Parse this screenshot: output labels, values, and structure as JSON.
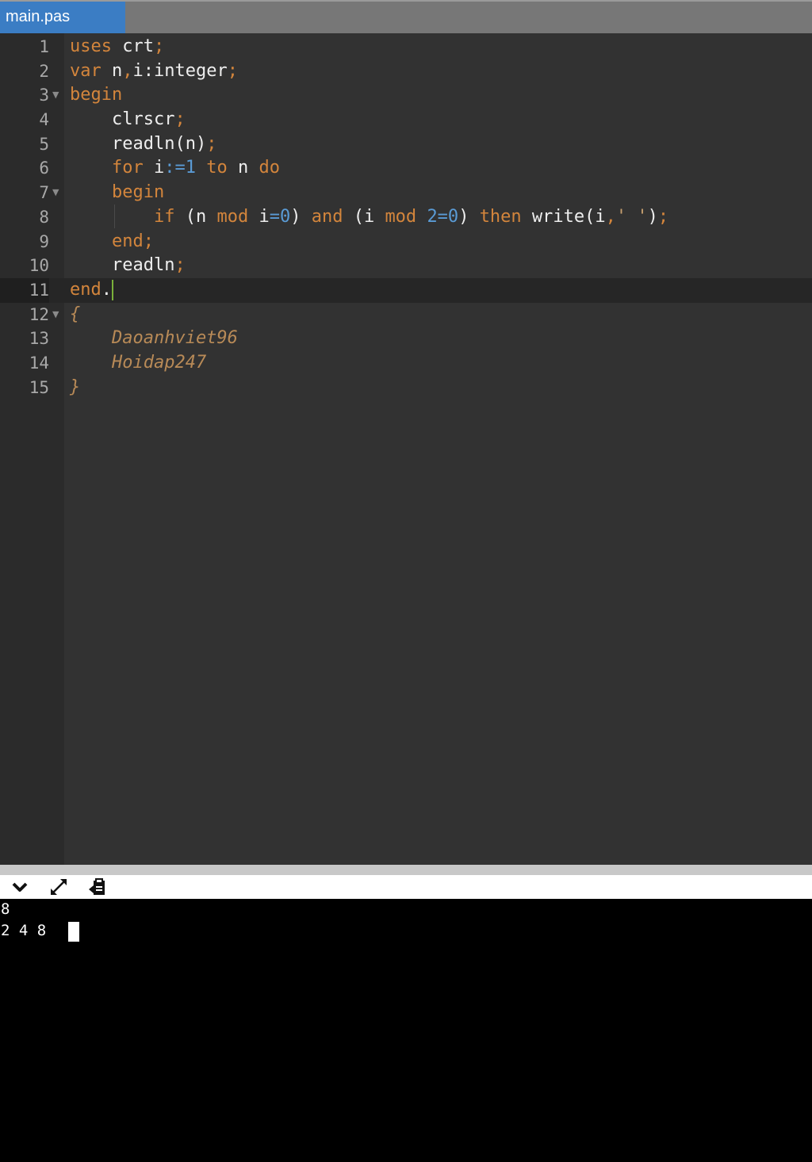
{
  "tab": {
    "filename": "main.pas"
  },
  "editor": {
    "line_numbers": [
      "1",
      "2",
      "3",
      "4",
      "5",
      "6",
      "7",
      "8",
      "9",
      "10",
      "11",
      "12",
      "13",
      "14",
      "15"
    ],
    "lines": [
      "uses crt;",
      "var n,i:integer;",
      "begin",
      "    clrscr;",
      "    readln(n);",
      "    for i:=1 to n do",
      "    begin",
      "        if (n mod i=0) and (i mod 2=0) then write(i,' ');",
      "    end;",
      "    readln;",
      "end.",
      "{",
      "    Daoanhviet96",
      "    Hoidap247",
      "}"
    ],
    "active_line": 11,
    "foldable_lines": [
      3,
      7,
      12
    ]
  },
  "toolbar": {
    "collapse_icon": "chevron-down-icon",
    "expand_icon": "expand-icon",
    "clear_icon": "clipboard-icon"
  },
  "console": {
    "lines": [
      "8",
      "2 4 8 "
    ]
  },
  "colors": {
    "keyword": "#d3853c",
    "number": "#5a9bd5",
    "tab_active": "#3b7dc4",
    "editor_bg": "#323232",
    "console_bg": "#000000"
  }
}
